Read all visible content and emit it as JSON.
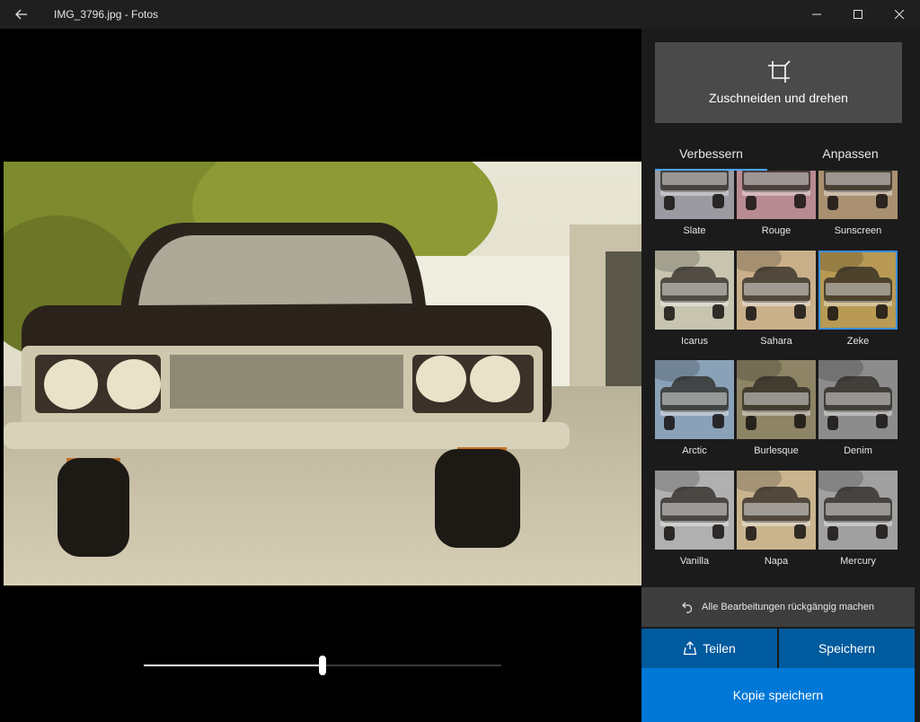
{
  "window": {
    "title": "IMG_3796.jpg - Fotos"
  },
  "colors": {
    "accent": "#0078d7",
    "accent_dark": "#005a9e",
    "tab_underline": "#4aa3ff",
    "panel_bg": "#1b1b1b",
    "titlebar_bg": "#1f1f1f"
  },
  "icons": {
    "back": "arrow-left-icon",
    "minimize": "minimize-icon",
    "maximize": "maximize-icon",
    "close": "close-icon",
    "crop": "crop-icon",
    "undo": "undo-icon",
    "share": "share-icon"
  },
  "editor": {
    "crop_label": "Zuschneiden und drehen",
    "tabs": [
      {
        "label": "Verbessern",
        "active": true
      },
      {
        "label": "Anpassen",
        "active": false
      }
    ],
    "filters": [
      {
        "label": "Slate",
        "tint": "#9a9aa0",
        "selected": false
      },
      {
        "label": "Rouge",
        "tint": "#b88a92",
        "selected": false
      },
      {
        "label": "Sunscreen",
        "tint": "#a89070",
        "selected": false
      },
      {
        "label": "Icarus",
        "tint": "#c7c4b0",
        "selected": false
      },
      {
        "label": "Sahara",
        "tint": "#c9b08a",
        "selected": false
      },
      {
        "label": "Zeke",
        "tint": "#b89a55",
        "selected": true
      },
      {
        "label": "Arctic",
        "tint": "#8aa2b8",
        "selected": false
      },
      {
        "label": "Burlesque",
        "tint": "#8e8466",
        "selected": false
      },
      {
        "label": "Denim",
        "tint": "#8c8c8c",
        "selected": false
      },
      {
        "label": "Vanilla",
        "tint": "#b0b0b0",
        "selected": false
      },
      {
        "label": "Napa",
        "tint": "#c9b48e",
        "selected": false
      },
      {
        "label": "Mercury",
        "tint": "#a0a0a0",
        "selected": false
      }
    ],
    "filter_intensity": 0.5,
    "undo_label": "Alle Bearbeitungen rückgängig machen",
    "share_label": "Teilen",
    "save_label": "Speichern",
    "save_copy_label": "Kopie speichern"
  }
}
